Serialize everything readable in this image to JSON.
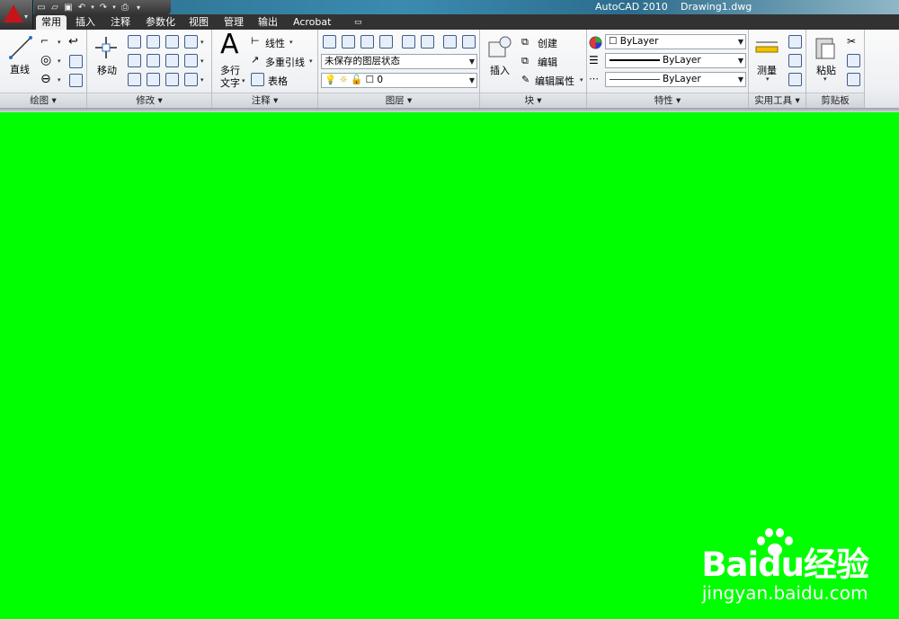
{
  "titlebar": {
    "app_name": "AutoCAD 2010",
    "file_name": "Drawing1.dwg"
  },
  "quick_access": {
    "icons": [
      "new-icon",
      "open-icon",
      "save-icon",
      "undo-icon",
      "redo-icon",
      "plot-icon",
      "more-icon"
    ]
  },
  "tabs": [
    {
      "label": "常用",
      "active": true
    },
    {
      "label": "插入",
      "active": false
    },
    {
      "label": "注释",
      "active": false
    },
    {
      "label": "参数化",
      "active": false
    },
    {
      "label": "视图",
      "active": false
    },
    {
      "label": "管理",
      "active": false
    },
    {
      "label": "输出",
      "active": false
    },
    {
      "label": "Acrobat",
      "active": false
    }
  ],
  "panels": {
    "draw": {
      "title": "绘图",
      "line_label": "直线"
    },
    "modify": {
      "title": "修改",
      "move_label": "移动"
    },
    "annotation": {
      "title": "注释",
      "mtext_label_1": "多行",
      "mtext_label_2": "文字",
      "linear_label": "线性",
      "mleader_label": "多重引线",
      "table_label": "表格"
    },
    "layers": {
      "title": "图层",
      "layer_state_value": "未保存的图层状态",
      "current_layer_value": "0"
    },
    "block": {
      "title": "块",
      "insert_label": "插入",
      "create_label": "创建",
      "edit_label": "编辑",
      "edit_attr_label": "编辑属性"
    },
    "properties": {
      "title": "特性",
      "color_value": "ByLayer",
      "linetype_value": "ByLayer",
      "lineweight_value": "ByLayer"
    },
    "utilities": {
      "title": "实用工具",
      "measure_label": "测量"
    },
    "clipboard": {
      "title": "剪贴板",
      "paste_label": "粘贴"
    }
  },
  "colors": {
    "canvas": "#00ff00",
    "tab_strip": "#323232",
    "title_bar": "#3b8bb0",
    "app_logo": "#c7141a"
  },
  "watermark": {
    "brand": "Baidu经验",
    "url": "jingyan.baidu.com"
  }
}
